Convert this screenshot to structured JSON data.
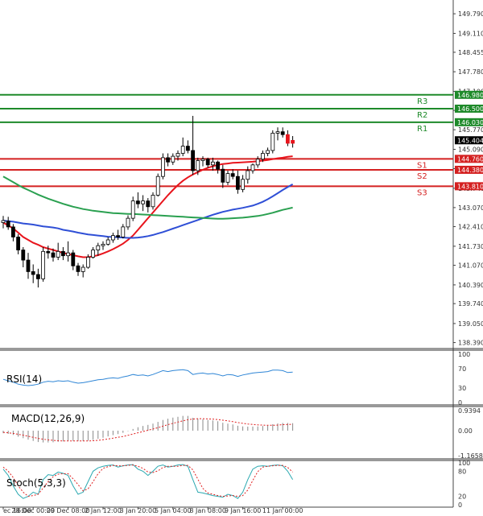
{
  "chart_data": {
    "type": "candlestick",
    "price_ticks": [
      "149.790",
      "149.110",
      "148.455",
      "147.780",
      "147.100",
      "146.440",
      "145.770",
      "145.090",
      "144.420",
      "143.740",
      "143.070",
      "142.410",
      "141.730",
      "141.070",
      "140.390",
      "139.740",
      "139.050",
      "138.390"
    ],
    "current_price": "145.404",
    "levels": [
      {
        "label": "R3",
        "value": "146.980",
        "kind": "resistance"
      },
      {
        "label": "R2",
        "value": "146.500",
        "kind": "resistance"
      },
      {
        "label": "R1",
        "value": "146.030",
        "kind": "resistance"
      },
      {
        "label": "S1",
        "value": "144.760",
        "kind": "support"
      },
      {
        "label": "S2",
        "value": "144.380",
        "kind": "support"
      },
      {
        "label": "S3",
        "value": "143.810",
        "kind": "support"
      }
    ],
    "candles": [
      {
        "o": 142.55,
        "h": 142.78,
        "l": 142.35,
        "c": 142.62
      },
      {
        "o": 142.6,
        "h": 142.75,
        "l": 142.3,
        "c": 142.4
      },
      {
        "o": 142.4,
        "h": 142.5,
        "l": 141.9,
        "c": 142.05
      },
      {
        "o": 142.05,
        "h": 142.15,
        "l": 141.45,
        "c": 141.6
      },
      {
        "o": 141.6,
        "h": 141.7,
        "l": 141.0,
        "c": 141.25
      },
      {
        "o": 141.25,
        "h": 141.5,
        "l": 140.6,
        "c": 140.85
      },
      {
        "o": 140.85,
        "h": 141.1,
        "l": 140.45,
        "c": 140.75
      },
      {
        "o": 140.75,
        "h": 140.95,
        "l": 140.3,
        "c": 140.6
      },
      {
        "o": 140.6,
        "h": 141.7,
        "l": 140.5,
        "c": 141.55
      },
      {
        "o": 141.55,
        "h": 141.75,
        "l": 141.3,
        "c": 141.5
      },
      {
        "o": 141.5,
        "h": 141.65,
        "l": 141.2,
        "c": 141.35
      },
      {
        "o": 141.35,
        "h": 141.85,
        "l": 141.25,
        "c": 141.55
      },
      {
        "o": 141.55,
        "h": 141.7,
        "l": 141.25,
        "c": 141.4
      },
      {
        "o": 141.4,
        "h": 141.9,
        "l": 141.2,
        "c": 141.5
      },
      {
        "o": 141.5,
        "h": 141.6,
        "l": 140.9,
        "c": 141.05
      },
      {
        "o": 141.05,
        "h": 141.15,
        "l": 140.7,
        "c": 140.85
      },
      {
        "o": 140.85,
        "h": 141.1,
        "l": 140.65,
        "c": 141.0
      },
      {
        "o": 141.0,
        "h": 141.45,
        "l": 140.95,
        "c": 141.35
      },
      {
        "o": 141.35,
        "h": 141.7,
        "l": 141.3,
        "c": 141.6
      },
      {
        "o": 141.6,
        "h": 141.85,
        "l": 141.4,
        "c": 141.75
      },
      {
        "o": 141.75,
        "h": 141.9,
        "l": 141.6,
        "c": 141.8
      },
      {
        "o": 141.8,
        "h": 142.05,
        "l": 141.75,
        "c": 141.95
      },
      {
        "o": 141.95,
        "h": 142.2,
        "l": 141.85,
        "c": 142.1
      },
      {
        "o": 142.1,
        "h": 142.3,
        "l": 141.95,
        "c": 142.05
      },
      {
        "o": 142.05,
        "h": 142.5,
        "l": 142.0,
        "c": 142.4
      },
      {
        "o": 142.4,
        "h": 142.8,
        "l": 142.3,
        "c": 142.7
      },
      {
        "o": 142.7,
        "h": 143.45,
        "l": 142.6,
        "c": 143.3
      },
      {
        "o": 143.3,
        "h": 143.6,
        "l": 143.05,
        "c": 143.2
      },
      {
        "o": 143.2,
        "h": 143.5,
        "l": 142.95,
        "c": 143.3
      },
      {
        "o": 143.3,
        "h": 143.4,
        "l": 142.9,
        "c": 143.1
      },
      {
        "o": 143.1,
        "h": 143.6,
        "l": 143.0,
        "c": 143.5
      },
      {
        "o": 143.5,
        "h": 144.25,
        "l": 143.45,
        "c": 144.15
      },
      {
        "o": 144.15,
        "h": 144.95,
        "l": 144.05,
        "c": 144.8
      },
      {
        "o": 144.8,
        "h": 144.95,
        "l": 144.5,
        "c": 144.65
      },
      {
        "o": 144.65,
        "h": 144.95,
        "l": 144.55,
        "c": 144.85
      },
      {
        "o": 144.85,
        "h": 145.05,
        "l": 144.7,
        "c": 144.95
      },
      {
        "o": 144.95,
        "h": 145.5,
        "l": 144.85,
        "c": 145.2
      },
      {
        "o": 145.2,
        "h": 145.4,
        "l": 144.95,
        "c": 145.05
      },
      {
        "o": 145.05,
        "h": 146.25,
        "l": 144.2,
        "c": 144.35
      },
      {
        "o": 144.35,
        "h": 144.8,
        "l": 144.2,
        "c": 144.7
      },
      {
        "o": 144.7,
        "h": 144.85,
        "l": 144.5,
        "c": 144.75
      },
      {
        "o": 144.75,
        "h": 144.8,
        "l": 144.45,
        "c": 144.55
      },
      {
        "o": 144.55,
        "h": 144.8,
        "l": 144.35,
        "c": 144.65
      },
      {
        "o": 144.65,
        "h": 144.7,
        "l": 144.25,
        "c": 144.4
      },
      {
        "o": 144.4,
        "h": 144.55,
        "l": 143.75,
        "c": 143.95
      },
      {
        "o": 143.95,
        "h": 144.35,
        "l": 143.85,
        "c": 144.25
      },
      {
        "o": 144.25,
        "h": 144.4,
        "l": 144.05,
        "c": 144.15
      },
      {
        "o": 144.15,
        "h": 144.35,
        "l": 143.55,
        "c": 143.7
      },
      {
        "o": 143.7,
        "h": 144.2,
        "l": 143.6,
        "c": 144.05
      },
      {
        "o": 144.05,
        "h": 144.5,
        "l": 143.9,
        "c": 144.35
      },
      {
        "o": 144.35,
        "h": 144.6,
        "l": 144.25,
        "c": 144.55
      },
      {
        "o": 144.55,
        "h": 144.85,
        "l": 144.45,
        "c": 144.75
      },
      {
        "o": 144.75,
        "h": 145.05,
        "l": 144.65,
        "c": 144.95
      },
      {
        "o": 144.95,
        "h": 145.15,
        "l": 144.85,
        "c": 145.05
      },
      {
        "o": 145.05,
        "h": 145.75,
        "l": 144.95,
        "c": 145.65
      },
      {
        "o": 145.65,
        "h": 145.85,
        "l": 145.4,
        "c": 145.7
      },
      {
        "o": 145.7,
        "h": 145.85,
        "l": 145.5,
        "c": 145.6
      },
      {
        "o": 145.6,
        "h": 145.75,
        "l": 145.2,
        "c": 145.3
      },
      {
        "o": 145.3,
        "h": 145.55,
        "l": 145.15,
        "c": 145.4
      }
    ],
    "moving_averages": [
      {
        "color": "#e8141c",
        "values": [
          142.55,
          142.45,
          142.35,
          142.2,
          142.05,
          141.95,
          141.85,
          141.78,
          141.7,
          141.65,
          141.6,
          141.55,
          141.5,
          141.46,
          141.42,
          141.38,
          141.35,
          141.35,
          141.38,
          141.42,
          141.48,
          141.55,
          141.63,
          141.72,
          141.82,
          141.95,
          142.1,
          142.3,
          142.5,
          142.7,
          142.9,
          143.1,
          143.3,
          143.5,
          143.68,
          143.85,
          144.0,
          144.12,
          144.22,
          144.3,
          144.38,
          144.45,
          144.5,
          144.55,
          144.58,
          144.6,
          144.62,
          144.63,
          144.64,
          144.65,
          144.66,
          144.68,
          144.7,
          144.72,
          144.75,
          144.78,
          144.8,
          144.83,
          144.85
        ]
      },
      {
        "color": "#2f4fd6",
        "values": [
          142.62,
          142.6,
          142.58,
          142.55,
          142.52,
          142.5,
          142.48,
          142.45,
          142.42,
          142.4,
          142.38,
          142.35,
          142.3,
          142.27,
          142.24,
          142.2,
          142.17,
          142.14,
          142.12,
          142.1,
          142.08,
          142.06,
          142.05,
          142.04,
          142.03,
          142.02,
          142.02,
          142.03,
          142.05,
          142.08,
          142.12,
          142.17,
          142.22,
          142.28,
          142.34,
          142.4,
          142.46,
          142.52,
          142.58,
          142.64,
          142.7,
          142.76,
          142.82,
          142.87,
          142.92,
          142.96,
          143.0,
          143.03,
          143.06,
          143.1,
          143.14,
          143.2,
          143.27,
          143.36,
          143.46,
          143.57,
          143.68,
          143.78,
          143.88
        ]
      },
      {
        "color": "#2aa050",
        "values": [
          144.15,
          144.05,
          143.95,
          143.85,
          143.76,
          143.68,
          143.6,
          143.52,
          143.45,
          143.38,
          143.32,
          143.26,
          143.2,
          143.15,
          143.1,
          143.06,
          143.02,
          142.99,
          142.96,
          142.94,
          142.92,
          142.9,
          142.88,
          142.87,
          142.86,
          142.85,
          142.85,
          142.84,
          142.83,
          142.82,
          142.81,
          142.8,
          142.79,
          142.78,
          142.77,
          142.76,
          142.75,
          142.74,
          142.73,
          142.72,
          142.71,
          142.7,
          142.69,
          142.68,
          142.68,
          142.69,
          142.7,
          142.71,
          142.72,
          142.74,
          142.76,
          142.78,
          142.81,
          142.85,
          142.89,
          142.94,
          142.99,
          143.03,
          143.07
        ]
      }
    ],
    "time_labels": [
      {
        "i": 0,
        "text": "ec 16:00"
      },
      {
        "i": 6,
        "text": "28 Dec 00:00"
      },
      {
        "i": 13,
        "text": "29 Dec 08:00"
      },
      {
        "i": 20,
        "text": "2 Jan 12:00"
      },
      {
        "i": 27,
        "text": "3 Jan 20:00"
      },
      {
        "i": 34,
        "text": "5 Jan 04:00"
      },
      {
        "i": 41,
        "text": "8 Jan 08:00"
      },
      {
        "i": 48,
        "text": "9 Jan 16:00"
      },
      {
        "i": 56,
        "text": "11 Jan 00:00"
      }
    ],
    "rsi": {
      "title": "RSI(14)",
      "ticks": [
        "100",
        "70",
        "30",
        "0"
      ],
      "values": [
        48,
        45,
        42,
        38,
        36,
        35,
        36,
        38,
        42,
        44,
        43,
        45,
        44,
        45,
        42,
        40,
        41,
        43,
        45,
        47,
        48,
        50,
        51,
        50,
        53,
        55,
        58,
        56,
        57,
        55,
        58,
        62,
        66,
        64,
        66,
        67,
        68,
        66,
        58,
        60,
        61,
        59,
        60,
        58,
        55,
        58,
        57,
        54,
        57,
        59,
        61,
        62,
        63,
        64,
        67,
        67,
        66,
        62,
        63
      ]
    },
    "macd": {
      "title": "MACD(12,26,9)",
      "ticks": [
        "0.9394",
        "0.00",
        "-1.1658"
      ],
      "histogram": [
        -0.12,
        -0.15,
        -0.2,
        -0.28,
        -0.35,
        -0.42,
        -0.48,
        -0.53,
        -0.55,
        -0.55,
        -0.54,
        -0.52,
        -0.5,
        -0.48,
        -0.48,
        -0.49,
        -0.49,
        -0.47,
        -0.43,
        -0.38,
        -0.33,
        -0.27,
        -0.21,
        -0.16,
        -0.1,
        -0.02,
        0.08,
        0.16,
        0.22,
        0.27,
        0.33,
        0.41,
        0.5,
        0.56,
        0.61,
        0.65,
        0.69,
        0.69,
        0.6,
        0.56,
        0.53,
        0.5,
        0.48,
        0.44,
        0.37,
        0.33,
        0.29,
        0.23,
        0.2,
        0.19,
        0.19,
        0.2,
        0.22,
        0.24,
        0.3,
        0.34,
        0.36,
        0.36,
        0.35
      ],
      "signal": [
        -0.08,
        -0.1,
        -0.13,
        -0.17,
        -0.21,
        -0.26,
        -0.31,
        -0.36,
        -0.4,
        -0.43,
        -0.45,
        -0.47,
        -0.48,
        -0.48,
        -0.48,
        -0.48,
        -0.48,
        -0.48,
        -0.47,
        -0.45,
        -0.42,
        -0.39,
        -0.35,
        -0.31,
        -0.27,
        -0.22,
        -0.16,
        -0.1,
        -0.04,
        0.02,
        0.08,
        0.14,
        0.21,
        0.28,
        0.34,
        0.4,
        0.46,
        0.51,
        0.54,
        0.56,
        0.56,
        0.55,
        0.54,
        0.52,
        0.49,
        0.46,
        0.42,
        0.38,
        0.34,
        0.31,
        0.29,
        0.27,
        0.26,
        0.25,
        0.25,
        0.26,
        0.28,
        0.29,
        0.3
      ]
    },
    "stoch": {
      "title": "Stoch(5,3,3)",
      "ticks": [
        "100",
        "80",
        "20",
        "0"
      ],
      "k": [
        85,
        70,
        45,
        25,
        15,
        20,
        30,
        25,
        60,
        72,
        70,
        78,
        75,
        70,
        45,
        25,
        30,
        55,
        80,
        88,
        92,
        94,
        95,
        90,
        93,
        95,
        96,
        85,
        80,
        70,
        80,
        92,
        95,
        90,
        92,
        95,
        96,
        92,
        60,
        30,
        28,
        25,
        22,
        20,
        18,
        25,
        22,
        15,
        30,
        60,
        85,
        92,
        93,
        92,
        94,
        95,
        93,
        80,
        60
      ],
      "d": [
        90,
        80,
        65,
        45,
        30,
        20,
        22,
        25,
        40,
        55,
        67,
        73,
        74,
        74,
        62,
        48,
        33,
        38,
        55,
        74,
        87,
        91,
        94,
        93,
        93,
        94,
        95,
        92,
        87,
        78,
        77,
        81,
        89,
        92,
        92,
        92,
        94,
        94,
        83,
        61,
        39,
        28,
        25,
        22,
        20,
        21,
        22,
        20,
        22,
        35,
        58,
        79,
        90,
        92,
        93,
        94,
        94,
        89,
        78
      ]
    }
  }
}
